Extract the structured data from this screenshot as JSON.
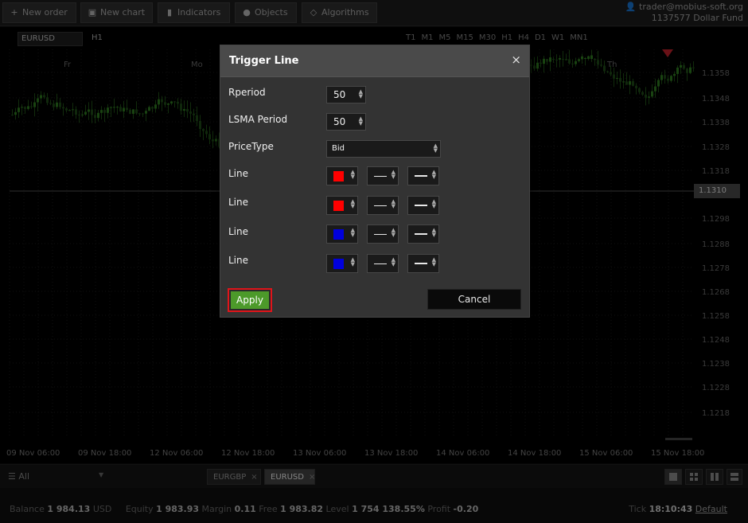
{
  "toolbar": {
    "new_order": "New order",
    "new_chart": "New chart",
    "indicators": "Indicators",
    "objects": "Objects",
    "algorithms": "Algorithms"
  },
  "account": {
    "user": "trader@mobius-soft.org",
    "id": "1137577",
    "fund": "Dollar Fund"
  },
  "chart": {
    "symbol": "EURUSD",
    "timeframe": "H1",
    "timeframes": [
      "T1",
      "M1",
      "M5",
      "M15",
      "M30",
      "H1",
      "H4",
      "D1",
      "W1",
      "MN1"
    ],
    "day_labels": [
      "Fr",
      "Mo",
      "Th"
    ],
    "current_price": "1.1310",
    "price_ticks": [
      "1.1358",
      "1.1348",
      "1.1338",
      "1.1328",
      "1.1318",
      "1.1298",
      "1.1288",
      "1.1278",
      "1.1268",
      "1.1258",
      "1.1248",
      "1.1238",
      "1.1228",
      "1.1218"
    ],
    "time_ticks": [
      "09 Nov 06:00",
      "09 Nov 18:00",
      "12 Nov 06:00",
      "12 Nov 18:00",
      "13 Nov 06:00",
      "13 Nov 18:00",
      "14 Nov 06:00",
      "14 Nov 18:00",
      "15 Nov 06:00",
      "15 Nov 18:00"
    ]
  },
  "dialog": {
    "title": "Trigger Line",
    "close": "×",
    "rperiod_label": "Rperiod",
    "rperiod_value": "50",
    "lsma_label": "LSMA Period",
    "lsma_value": "50",
    "pricetype_label": "PriceType",
    "pricetype_value": "Bid",
    "lines": [
      {
        "label": "Line",
        "color": "#ff0000"
      },
      {
        "label": "Line",
        "color": "#ff0000"
      },
      {
        "label": "Line",
        "color": "#0000dd"
      },
      {
        "label": "Line",
        "color": "#0000dd"
      }
    ],
    "apply": "Apply",
    "cancel": "Cancel"
  },
  "tabs": {
    "filter": "All",
    "symbols": [
      "EURGBP",
      "EURUSD"
    ]
  },
  "status": {
    "balance_label": "Balance",
    "balance": "1 984.13",
    "currency": "USD",
    "equity_label": "Equity",
    "equity": "1 983.93",
    "margin_label": "Margin",
    "margin": "0.11",
    "free_label": "Free",
    "free": "1 983.82",
    "level_label": "Level",
    "level": "1 754 138.55%",
    "profit_label": "Profit",
    "profit": "-0.20",
    "tick_label": "Tick",
    "tick_time": "18:10:43",
    "tick_mode": "Default"
  }
}
